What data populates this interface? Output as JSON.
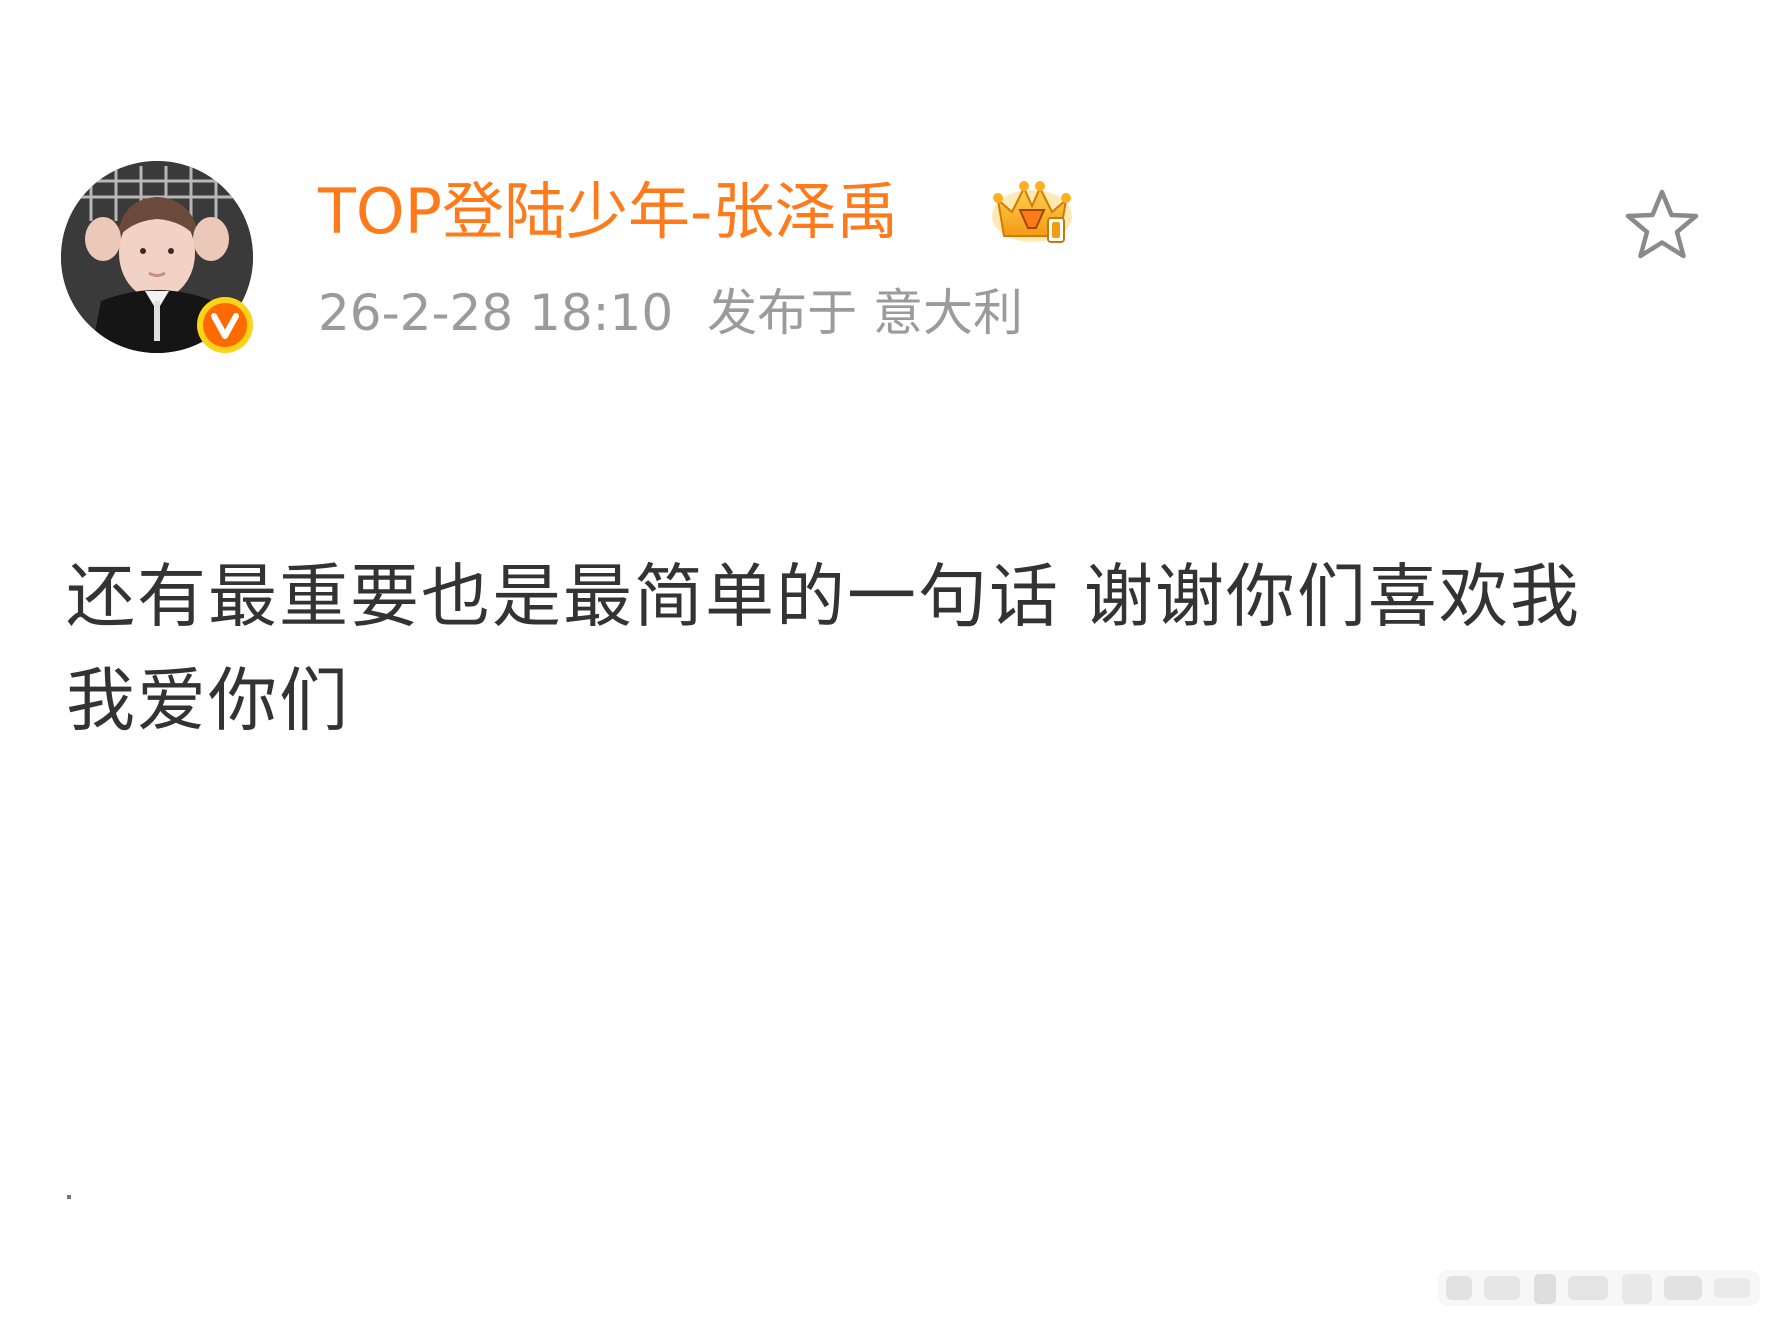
{
  "post": {
    "user_name": "TOP登陆少年-张泽禹",
    "timestamp": "26-2-28 18:10",
    "location": "发布于 意大利",
    "text_line_1": "还有最重要也是最简单的一句话 谢谢你们喜欢我",
    "text_line_2": "我爱你们"
  },
  "icons": {
    "avatar": "avatar-photo",
    "verified": "verified-v-icon",
    "crown": "crown-badge-icon",
    "star": "star-icon",
    "watermark": "weibo-watermark"
  },
  "colors": {
    "name": "#ff7a1a",
    "meta": "#9b9b9b",
    "text": "#333333",
    "verified_bg": "#ff7a00",
    "verified_ring": "#ffd21a",
    "star_stroke": "#8a8a8a"
  }
}
